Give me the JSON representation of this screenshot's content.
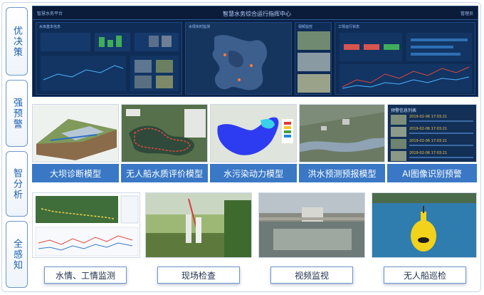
{
  "sidebar": {
    "items": [
      {
        "label": "优决策"
      },
      {
        "label": "强预警"
      },
      {
        "label": "智分析"
      },
      {
        "label": "全感知"
      }
    ]
  },
  "dashboard": {
    "title": "智慧水务综合运行指挥中心",
    "brand": "智慧水务平台",
    "user": "管理员",
    "panels": [
      {
        "title": "水库基本信息"
      },
      {
        "title": "水情实时监测"
      },
      {
        "title": "视频监控"
      },
      {
        "title": "工情运行状态"
      }
    ]
  },
  "models": [
    {
      "label": "大坝诊断模型"
    },
    {
      "label": "无人船水质评价模型"
    },
    {
      "label": "水污染动力模型"
    },
    {
      "label": "洪水预测预报模型"
    },
    {
      "label": "AI图像识别预警"
    }
  ],
  "alerts": {
    "header": "预警信息列表",
    "items": [
      "2019-02-06 17:03:21",
      "2019-02-06 17:03:21",
      "2019-02-06 17:03:21",
      "2019-02-06 17:03:21"
    ]
  },
  "sensing": [
    {
      "label": "水情、工情监测"
    },
    {
      "label": "现场检查"
    },
    {
      "label": "视频监视"
    },
    {
      "label": "无人船巡检"
    }
  ],
  "colors": {
    "accent": "#3a78c6",
    "dashboard_bg": "#0b2245",
    "sidebar_text": "#1f5fae"
  }
}
